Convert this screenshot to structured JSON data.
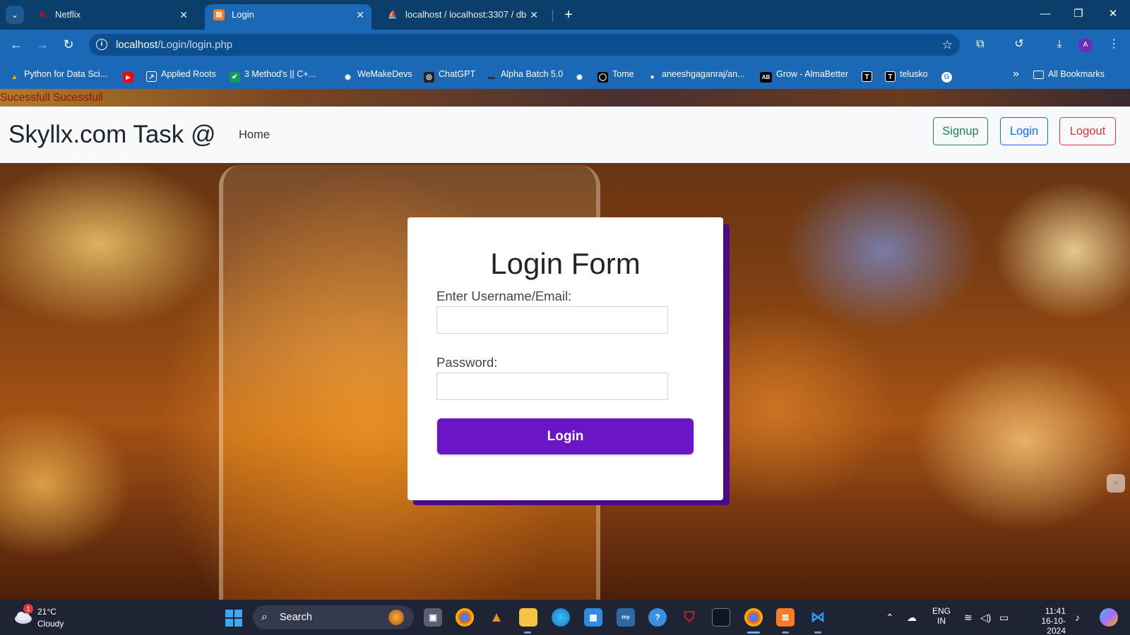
{
  "browser": {
    "tabs": [
      {
        "title": "Netflix",
        "icon": "netflix-icon",
        "icon_glyph": "N",
        "icon_color": "#e50914"
      },
      {
        "title": "Login",
        "icon": "xampp-icon",
        "icon_glyph": "⊠",
        "icon_color": "#fb7a24"
      },
      {
        "title": "localhost / localhost:3307 / db",
        "icon": "phpmyadmin-icon",
        "icon_glyph": "⛵",
        "icon_color": "#f89c0e"
      }
    ],
    "tab_close_glyph": "✕",
    "new_tab_glyph": "+",
    "tab_search_glyph": "⌄",
    "window_controls": {
      "minimize": "—",
      "restore": "❐",
      "close": "✕"
    },
    "address": {
      "host": "localhost",
      "path": "/Login/login.php"
    },
    "profile_initial": "A",
    "bookmarks": [
      {
        "label": "Python for Data Sci...",
        "icon": "google-drive-icon",
        "glyph": "▲",
        "color": "#f4b400"
      },
      {
        "label": "",
        "icon": "youtube-icon",
        "glyph": "▶",
        "color": "#ff0000"
      },
      {
        "label": "Applied Roots",
        "icon": "applied-roots-icon",
        "glyph": "↗",
        "color": "#ffffff"
      },
      {
        "label": "3 Method's || C+...",
        "icon": "check-icon",
        "glyph": "✔",
        "color": "#0f9d58"
      },
      {
        "label": "WeMakeDevs",
        "icon": "globe-icon",
        "glyph": "◉",
        "color": "#ffffff"
      },
      {
        "label": "ChatGPT",
        "icon": "chatgpt-icon",
        "glyph": "◎",
        "color": "#202123"
      },
      {
        "label": "Alpha Batch 5.0",
        "icon": "dash-icon",
        "glyph": "▬",
        "color": "#222222"
      },
      {
        "label": "",
        "icon": "globe-icon",
        "glyph": "◉",
        "color": "#ffffff"
      },
      {
        "label": "Tome",
        "icon": "tome-icon",
        "glyph": "◯",
        "color": "#000000"
      },
      {
        "label": "aneeshgaganraj/an...",
        "icon": "github-icon",
        "glyph": "●",
        "color": "#ffffff"
      },
      {
        "label": "Grow - AlmaBetter",
        "icon": "almabetter-icon",
        "glyph": "AB",
        "color": "#000000"
      },
      {
        "label": "",
        "icon": "t-icon",
        "glyph": "T",
        "color": "#000000"
      },
      {
        "label": "telusko",
        "icon": "t-icon",
        "glyph": "T",
        "color": "#000000"
      },
      {
        "label": "",
        "icon": "google-icon",
        "glyph": "G",
        "color": "#ffffff"
      }
    ],
    "overflow_glyph": "»",
    "all_bookmarks": "All Bookmarks"
  },
  "page": {
    "alert": "Sucessfull Sucessfull",
    "brand": "Skyllx.com Task @",
    "nav_home": "Home",
    "buttons": {
      "signup": "Signup",
      "login": "Login",
      "logout": "Logout"
    },
    "form": {
      "title": "Login Form",
      "username_label": "Enter Username/Email:",
      "username_value": "",
      "password_label": "Password:",
      "password_value": "",
      "submit_label": "Login"
    },
    "colors": {
      "accent": "#6a16c7",
      "shadow": "#4b0b86",
      "success": "#198754",
      "primary": "#0d6efd",
      "danger": "#dc3545",
      "alert_text": "#8b1a10"
    }
  },
  "taskbar": {
    "weather": {
      "temp": "21°C",
      "desc": "Cloudy",
      "badge": "1"
    },
    "search_placeholder": "Search",
    "apps": [
      "task-view-icon",
      "chrome-icon",
      "vlc-icon",
      "file-explorer-icon",
      "edge-icon",
      "store-icon",
      "mysql-icon",
      "help-icon",
      "mcafee-icon",
      "terminal-icon",
      "chrome-profile-icon",
      "xampp-icon",
      "vscode-icon"
    ],
    "lang_top": "ENG",
    "lang_bottom": "IN",
    "time": "11:41",
    "date": "16-10-2024"
  }
}
